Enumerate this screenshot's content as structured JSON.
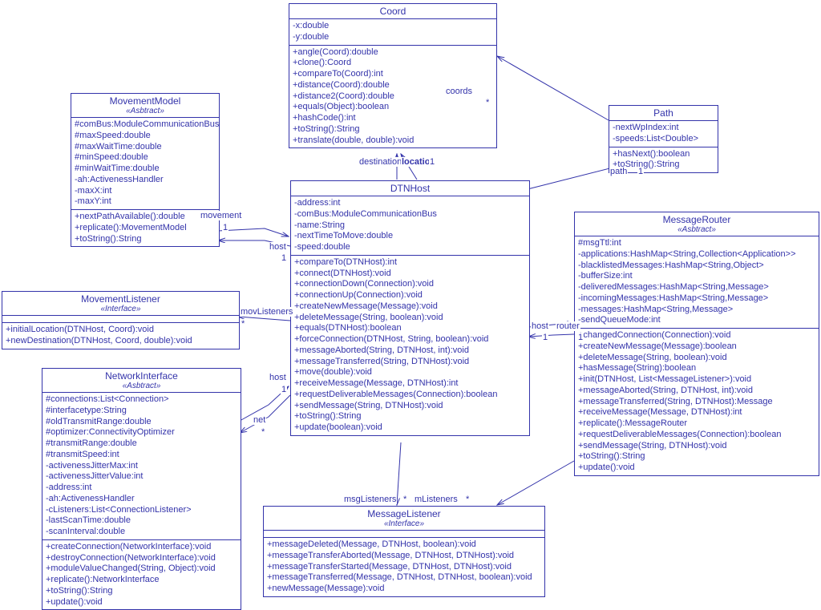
{
  "classes": {
    "coord": {
      "name": "Coord",
      "attrs": [
        "-x:double",
        "-y:double"
      ],
      "ops": [
        "+angle(Coord):double",
        "+clone():Coord",
        "+compareTo(Coord):int",
        "+distance(Coord):double",
        "+distance2(Coord):double",
        "+equals(Object):boolean",
        "+hashCode():int",
        "+toString():String",
        "+translate(double, double):void"
      ]
    },
    "path": {
      "name": "Path",
      "attrs": [
        "-nextWpIndex:int",
        "-speeds:List<Double>"
      ],
      "ops": [
        "+hasNext():boolean",
        "+toString():String"
      ]
    },
    "movementModel": {
      "name": "MovementModel",
      "stereo": "«Asbtract»",
      "attrs": [
        "#comBus:ModuleCommunicationBus",
        "#maxSpeed:double",
        "#maxWaitTime:double",
        "#minSpeed:double",
        "#minWaitTime:double",
        "-ah:ActivenessHandler",
        "-maxX:int",
        "-maxY:int"
      ],
      "ops": [
        "+nextPathAvailable():double",
        "+replicate():MovementModel",
        "+toString():String"
      ]
    },
    "movementListener": {
      "name": "MovementListener",
      "stereo": "«Interface»",
      "ops": [
        "+initialLocation(DTNHost, Coord):void",
        "+newDestination(DTNHost, Coord, double):void"
      ]
    },
    "networkInterface": {
      "name": "NetworkInterface",
      "stereo": "«Asbtract»",
      "attrs": [
        "#connections:List<Connection>",
        "#interfacetype:String",
        "#oldTransmitRange:double",
        "#optimizer:ConnectivityOptimizer",
        "#transmitRange:double",
        "#transmitSpeed:int",
        "-activenessJitterMax:int",
        "-activenessJitterValue:int",
        "-address:int",
        "-ah:ActivenessHandler",
        "-cListeners:List<ConnectionListener>",
        "-lastScanTime:double",
        "-scanInterval:double"
      ],
      "ops": [
        "+createConnection(NetworkInterface):void",
        "+destroyConnection(NetworkInterface):void",
        "+moduleValueChanged(String, Object):void",
        "+replicate():NetworkInterface",
        "+toString():String",
        "+update():void"
      ]
    },
    "dtnhost": {
      "name": "DTNHost",
      "attrs": [
        "-address:int",
        "-comBus:ModuleCommunicationBus",
        "-name:String",
        "-nextTimeToMove:double",
        "-speed:double"
      ],
      "ops": [
        "+compareTo(DTNHost):int",
        "+connect(DTNHost):void",
        "+connectionDown(Connection):void",
        "+connectionUp(Connection):void",
        "+createNewMessage(Message):void",
        "+deleteMessage(String, boolean):void",
        "+equals(DTNHost):boolean",
        "+forceConnection(DTNHost, String, boolean):void",
        "+messageAborted(String, DTNHost, int):void",
        "+messageTransferred(String, DTNHost):void",
        "+move(double):void",
        "+receiveMessage(Message, DTNHost):int",
        "+requestDeliverableMessages(Connection):boolean",
        "+sendMessage(String, DTNHost):void",
        "+toString():String",
        "+update(boolean):void"
      ]
    },
    "messageRouter": {
      "name": "MessageRouter",
      "stereo": "«Asbtract»",
      "attrs": [
        "#msgTtl:int",
        "-applications:HashMap<String,Collection<Application>>",
        "-blacklistedMessages:HashMap<String,Object>",
        "-bufferSize:int",
        "-deliveredMessages:HashMap<String,Message>",
        "-incomingMessages:HashMap<String,Message>",
        "-messages:HashMap<String,Message>",
        "-sendQueueMode:int"
      ],
      "ops": [
        "+changedConnection(Connection):void",
        "+createNewMessage(Message):boolean",
        "+deleteMessage(String, boolean):void",
        "+hasMessage(String):boolean",
        "+init(DTNHost, List<MessageListener>):void",
        "+messageAborted(String, DTNHost, int):void",
        "+messageTransferred(String, DTNHost):Message",
        "+receiveMessage(Message, DTNHost):int",
        "+replicate():MessageRouter",
        "+requestDeliverableMessages(Connection):boolean",
        "+sendMessage(String, DTNHost):void",
        "+toString():String",
        "+update():void"
      ]
    },
    "messageListener": {
      "name": "MessageListener",
      "stereo": "«Interface»",
      "ops": [
        "+messageDeleted(Message, DTNHost, boolean):void",
        "+messageTransferAborted(Message, DTNHost, DTNHost):void",
        "+messageTransferStarted(Message, DTNHost, DTNHost):void",
        "+messageTransferred(Message, DTNHost, DTNHost, boolean):void",
        "+newMessage(Message):void"
      ]
    }
  },
  "labels": {
    "coords": "coords",
    "star": "*",
    "path": "path",
    "one": "1",
    "destination": "destination",
    "location": "location",
    "movement": "movement",
    "host": "host",
    "movListeners": "movListeners",
    "net": "net",
    "router": "router",
    "msgListeners": "msgListeners",
    "mListeners": "mListeners"
  }
}
